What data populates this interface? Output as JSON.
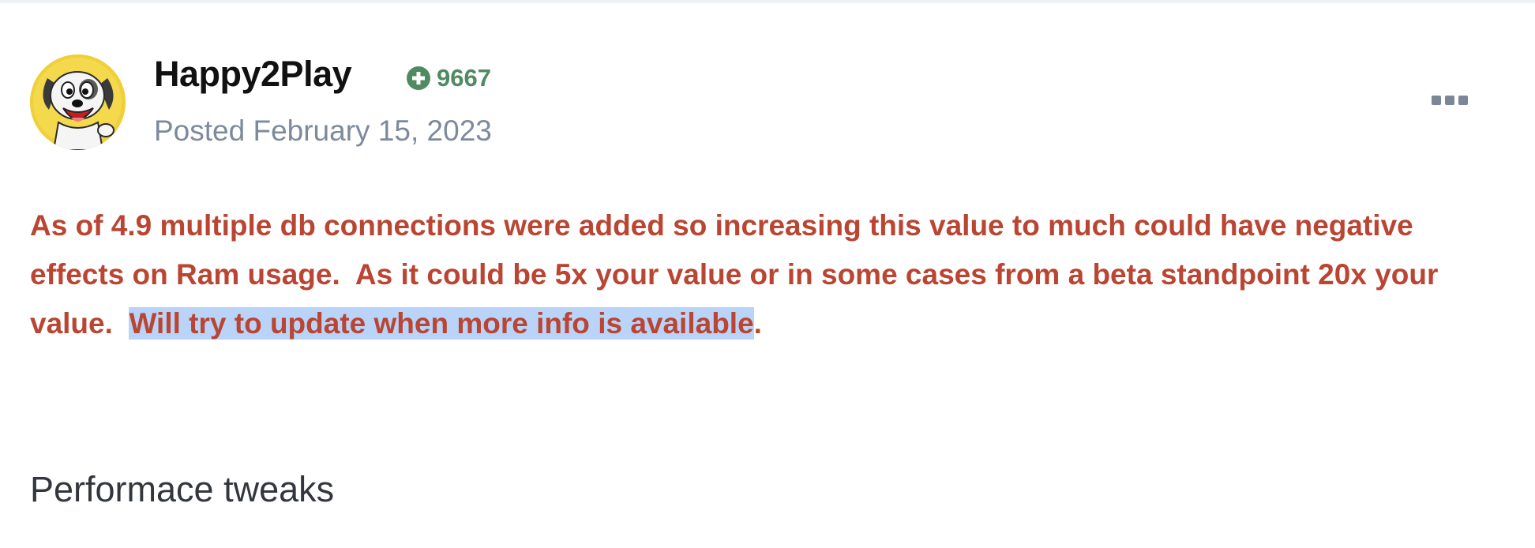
{
  "post": {
    "author": {
      "name": "Happy2Play",
      "reputation": "9667",
      "reputation_icon": "plus-circle-icon",
      "avatar_icon": "cartoon-dog-avatar"
    },
    "posted_label": "Posted",
    "posted_date": "February 15, 2023",
    "more_icon": "ellipsis-icon",
    "body": {
      "text_before_selection": "As of 4.9 multiple db connections were added so increasing this value to much could have negative effects on Ram usage.  As it could be 5x your value or in some cases from a beta standpoint 20x your value.  ",
      "selected_text": "Will try to update when more info is available",
      "text_after_selection": ".",
      "color": "#b94532",
      "selection_color": "#b9d4f8"
    },
    "subheading": "Performace tweaks"
  }
}
